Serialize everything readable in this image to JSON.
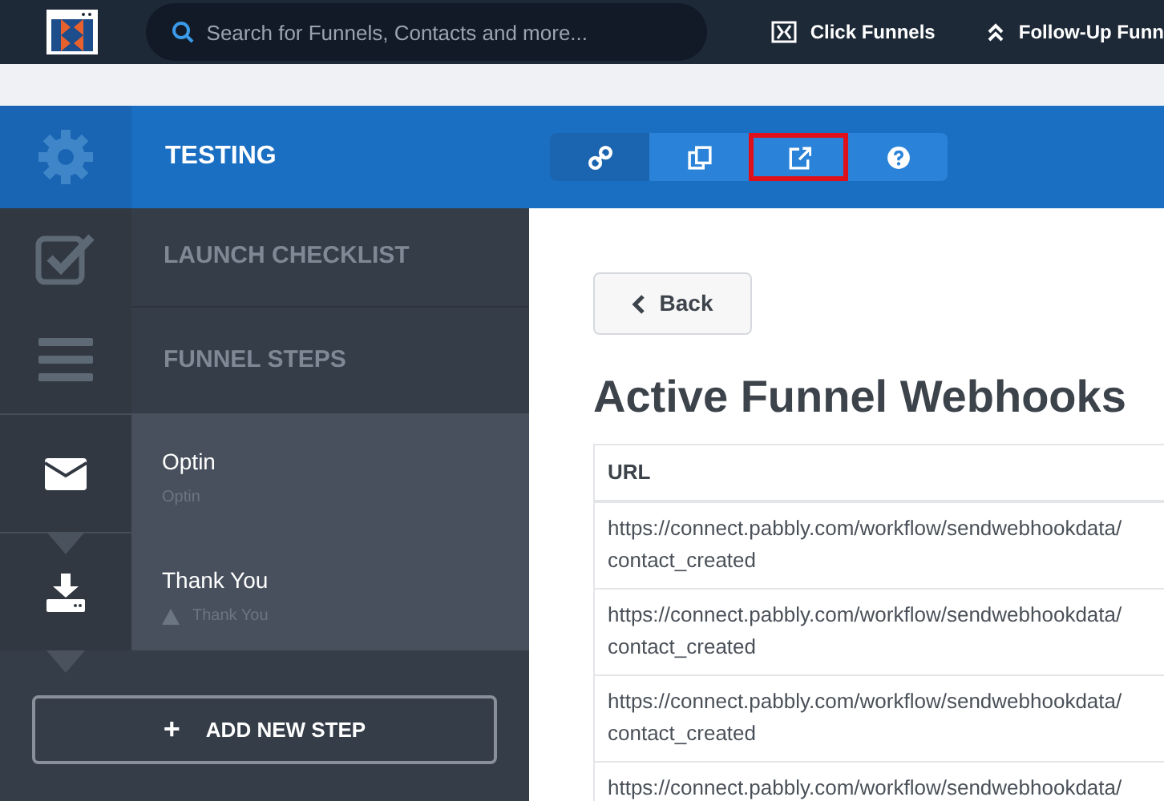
{
  "topbar": {
    "search": {
      "placeholder": "Search for Funnels, Contacts and more..."
    },
    "nav": [
      {
        "kind": "funnels",
        "label": "Click Funnels"
      },
      {
        "kind": "followup",
        "label": "Follow-Up Funn"
      }
    ]
  },
  "header": {
    "title": "TESTING",
    "tools": [
      {
        "kind": "link",
        "selected": true,
        "highlighted": false
      },
      {
        "kind": "copy",
        "selected": false,
        "highlighted": false
      },
      {
        "kind": "external",
        "selected": false,
        "highlighted": true
      },
      {
        "kind": "help",
        "selected": false,
        "highlighted": false
      }
    ]
  },
  "sidebar": {
    "sections": [
      {
        "kind": "checklist",
        "label": "LAUNCH CHECKLIST"
      },
      {
        "kind": "steps",
        "label": "FUNNEL STEPS"
      }
    ],
    "steps": [
      {
        "kind": "optin",
        "title": "Optin",
        "subtitle": "Optin",
        "warning": false
      },
      {
        "kind": "thankyou",
        "title": "Thank You",
        "subtitle": "Thank You",
        "warning": true
      }
    ],
    "add_button": {
      "icon": "+",
      "label": "ADD NEW STEP"
    }
  },
  "main": {
    "back_button": "Back",
    "heading": "Active Funnel Webhooks",
    "table": {
      "columns": [
        "URL"
      ],
      "rows": [
        {
          "url": "https://connect.pabbly.com/workflow/sendwebhookdata/contact_created"
        },
        {
          "url": "https://connect.pabbly.com/workflow/sendwebhookdata/contact_created"
        },
        {
          "url": "https://connect.pabbly.com/workflow/sendwebhookdata/contact_created"
        },
        {
          "url": "https://connect.pabbly.com/workflow/sendwebhookdata/"
        }
      ]
    }
  }
}
